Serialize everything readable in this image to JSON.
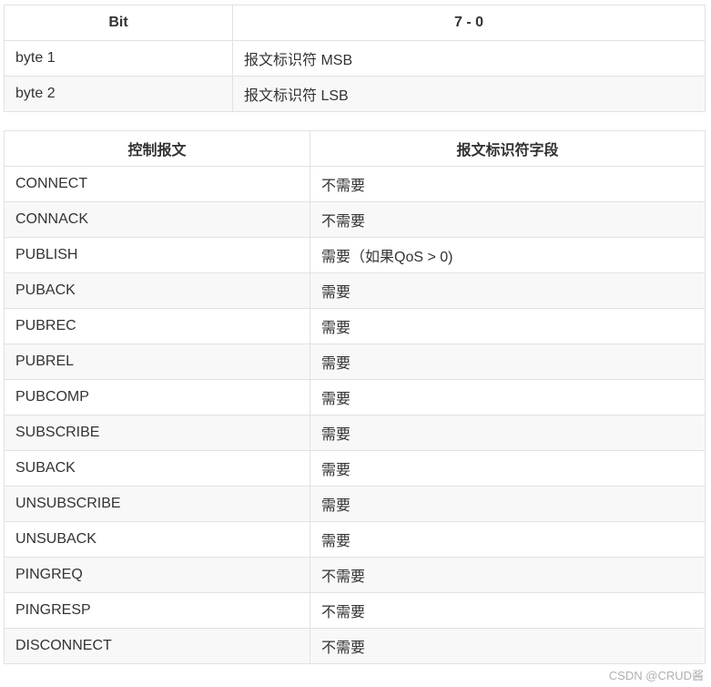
{
  "bit_table": {
    "headers": [
      "Bit",
      "7 - 0"
    ],
    "rows": [
      [
        "byte 1",
        "报文标识符 MSB"
      ],
      [
        "byte 2",
        "报文标识符 LSB"
      ]
    ]
  },
  "packet_table": {
    "headers": [
      "控制报文",
      "报文标识符字段"
    ],
    "rows": [
      [
        "CONNECT",
        "不需要"
      ],
      [
        "CONNACK",
        "不需要"
      ],
      [
        "PUBLISH",
        "需要（如果QoS > 0)"
      ],
      [
        "PUBACK",
        "需要"
      ],
      [
        "PUBREC",
        "需要"
      ],
      [
        "PUBREL",
        "需要"
      ],
      [
        "PUBCOMP",
        "需要"
      ],
      [
        "SUBSCRIBE",
        "需要"
      ],
      [
        "SUBACK",
        "需要"
      ],
      [
        "UNSUBSCRIBE",
        "需要"
      ],
      [
        "UNSUBACK",
        "需要"
      ],
      [
        "PINGREQ",
        "不需要"
      ],
      [
        "PINGRESP",
        "不需要"
      ],
      [
        "DISCONNECT",
        "不需要"
      ]
    ]
  },
  "watermark": "CSDN @CRUD酱"
}
